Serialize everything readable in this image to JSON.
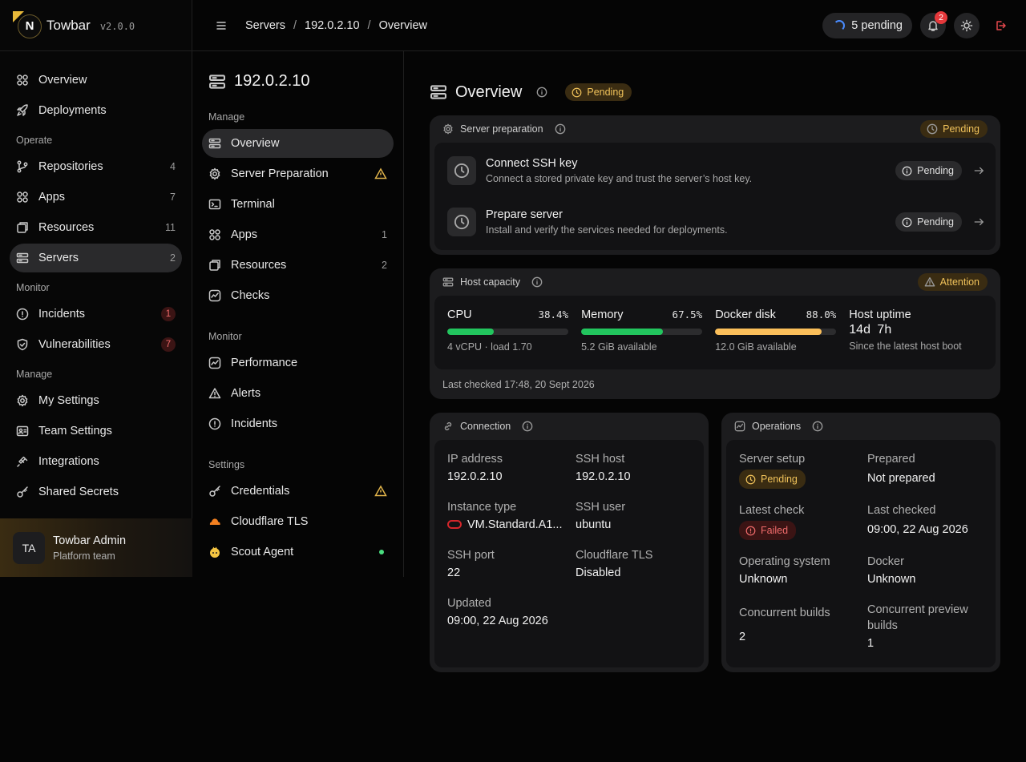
{
  "brand": {
    "name": "Towbar",
    "version": "v2.0.0",
    "logo_letter": "N"
  },
  "sidebar": {
    "items_top": [
      {
        "label": "Overview",
        "icon": "grid-icon"
      },
      {
        "label": "Deployments",
        "icon": "rocket-icon"
      }
    ],
    "operate_label": "Operate",
    "operate": [
      {
        "label": "Repositories",
        "count": "4",
        "icon": "git-icon"
      },
      {
        "label": "Apps",
        "count": "7",
        "icon": "grid-icon"
      },
      {
        "label": "Resources",
        "count": "11",
        "icon": "box-icon"
      },
      {
        "label": "Servers",
        "count": "2",
        "icon": "server-icon",
        "active": true
      }
    ],
    "monitor_label": "Monitor",
    "monitor": [
      {
        "label": "Incidents",
        "count": "1",
        "icon": "alert-circle-icon"
      },
      {
        "label": "Vulnerabilities",
        "count": "7",
        "icon": "shield-icon"
      }
    ],
    "manage_label": "Manage",
    "manage": [
      {
        "label": "My Settings",
        "icon": "gear-icon"
      },
      {
        "label": "Team Settings",
        "icon": "team-card-icon"
      },
      {
        "label": "Integrations",
        "icon": "plug-icon"
      },
      {
        "label": "Shared Secrets",
        "icon": "key-icon"
      }
    ]
  },
  "user": {
    "initials": "TA",
    "name": "Towbar Admin",
    "team": "Platform team"
  },
  "topbar": {
    "breadcrumbs": [
      "Servers",
      "192.0.2.10",
      "Overview"
    ],
    "pending_label": "5 pending",
    "notifications_count": "2"
  },
  "subnav": {
    "title": "192.0.2.10",
    "manage_label": "Manage",
    "manage": [
      {
        "label": "Overview",
        "icon": "server-icon",
        "active": true
      },
      {
        "label": "Server Preparation",
        "icon": "gear-icon",
        "warning": true
      },
      {
        "label": "Terminal",
        "icon": "terminal-icon"
      },
      {
        "label": "Apps",
        "count": "1",
        "icon": "grid-icon"
      },
      {
        "label": "Resources",
        "count": "2",
        "icon": "box-icon"
      },
      {
        "label": "Checks",
        "icon": "pulse-icon"
      }
    ],
    "monitor_label": "Monitor",
    "monitor": [
      {
        "label": "Performance",
        "icon": "pulse-icon"
      },
      {
        "label": "Alerts",
        "icon": "warning-icon"
      },
      {
        "label": "Incidents",
        "icon": "alert-circle-icon"
      }
    ],
    "settings_label": "Settings",
    "settings": [
      {
        "label": "Credentials",
        "icon": "key-icon",
        "warning": true
      },
      {
        "label": "Cloudflare TLS",
        "icon": "cloudflare-icon"
      },
      {
        "label": "Scout Agent",
        "icon": "scout-icon",
        "status": "online"
      }
    ]
  },
  "main": {
    "title": "Overview",
    "status": "Pending",
    "prep": {
      "title": "Server preparation",
      "status": "Pending",
      "steps": [
        {
          "title": "Connect SSH key",
          "desc": "Connect a stored private key and trust the server’s host key.",
          "status": "Pending"
        },
        {
          "title": "Prepare server",
          "desc": "Install and verify the services needed for deployments.",
          "status": "Pending"
        }
      ]
    },
    "capacity": {
      "title": "Host capacity",
      "status": "Attention",
      "metrics": [
        {
          "label": "CPU",
          "pct": "38.4%",
          "value": 38.4,
          "sub": "4 vCPU · load 1.70",
          "color": "#22c55e"
        },
        {
          "label": "Memory",
          "pct": "67.5%",
          "value": 67.5,
          "sub": "5.2 GiB available",
          "color": "#22c55e"
        },
        {
          "label": "Docker disk",
          "pct": "88.0%",
          "value": 88.0,
          "sub": "12.0 GiB available",
          "color": "#fbbf5a"
        }
      ],
      "uptime": {
        "label": "Host uptime",
        "value": "14d 7h",
        "sub": "Since the latest host boot"
      },
      "last_checked": "Last checked 17:48, 20 Sept 2026"
    },
    "connection": {
      "title": "Connection",
      "ip_label": "IP address",
      "ip": "192.0.2.10",
      "host_label": "SSH host",
      "host": "192.0.2.10",
      "instance_label": "Instance type",
      "instance": "VM.Standard.A1...",
      "user_label": "SSH user",
      "user": "ubuntu",
      "port_label": "SSH port",
      "port": "22",
      "tls_label": "Cloudflare TLS",
      "tls": "Disabled",
      "updated_label": "Updated",
      "updated": "09:00, 22 Aug 2026"
    },
    "operations": {
      "title": "Operations",
      "setup_label": "Server setup",
      "setup": "Pending",
      "prepared_label": "Prepared",
      "prepared": "Not prepared",
      "latest_label": "Latest check",
      "latest": "Failed",
      "last_label": "Last checked",
      "last": "09:00, 22 Aug 2026",
      "os_label": "Operating system",
      "os": "Unknown",
      "docker_label": "Docker",
      "docker": "Unknown",
      "builds_label": "Concurrent builds",
      "builds": "2",
      "preview_label": "Concurrent preview builds",
      "preview": "1"
    }
  }
}
